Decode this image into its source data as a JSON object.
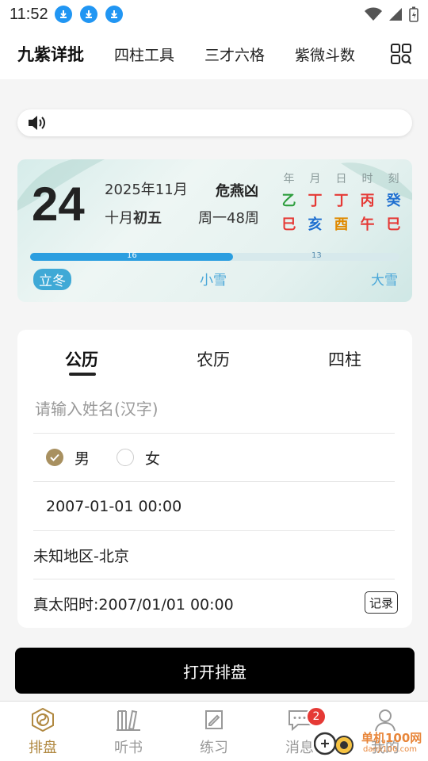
{
  "status": {
    "time": "11:52"
  },
  "topnav": {
    "brand": "九紫详批",
    "items": [
      "四柱工具",
      "三才六格",
      "紫微斗数"
    ]
  },
  "calendar": {
    "day": "24",
    "year_month": "2025年11月",
    "lunar_prefix": "十月",
    "lunar_day": "初五",
    "omen": "危燕凶",
    "week": "周一48周",
    "pillar_headers": [
      "年",
      "月",
      "日",
      "时",
      "刻"
    ],
    "stems": [
      {
        "char": "乙",
        "color": "#2e9e3e"
      },
      {
        "char": "丁",
        "color": "#e53935"
      },
      {
        "char": "丁",
        "color": "#e53935"
      },
      {
        "char": "丙",
        "color": "#e53935"
      },
      {
        "char": "癸",
        "color": "#1e6fd0"
      }
    ],
    "branches": [
      {
        "char": "巳",
        "color": "#e53935"
      },
      {
        "char": "亥",
        "color": "#1e6fd0"
      },
      {
        "char": "酉",
        "color": "#e08a00"
      },
      {
        "char": "午",
        "color": "#e53935"
      },
      {
        "char": "巳",
        "color": "#e53935"
      }
    ],
    "progress": {
      "elapsed": "16",
      "remaining": "13",
      "fraction": 0.55
    },
    "terms": {
      "current": "立冬",
      "next": "小雪",
      "following": "大雪"
    }
  },
  "form": {
    "tabs": [
      "公历",
      "农历",
      "四柱"
    ],
    "name_placeholder": "请输入姓名(汉字)",
    "gender": {
      "male": "男",
      "female": "女",
      "selected": "male"
    },
    "datetime": "2007-01-01 00:00",
    "location": "未知地区-北京",
    "solar_time": "真太阳时:2007/01/01 00:00",
    "record_label": "记录"
  },
  "open_button": "打开排盘",
  "bottom_nav": {
    "items": [
      "排盘",
      "听书",
      "练习",
      "消息",
      "我的"
    ],
    "badge": "2"
  },
  "watermark": {
    "text": "单机100网",
    "sub": "danji100.com"
  },
  "colors": {
    "accent": "#b08840",
    "primary_bg": "#000000"
  }
}
